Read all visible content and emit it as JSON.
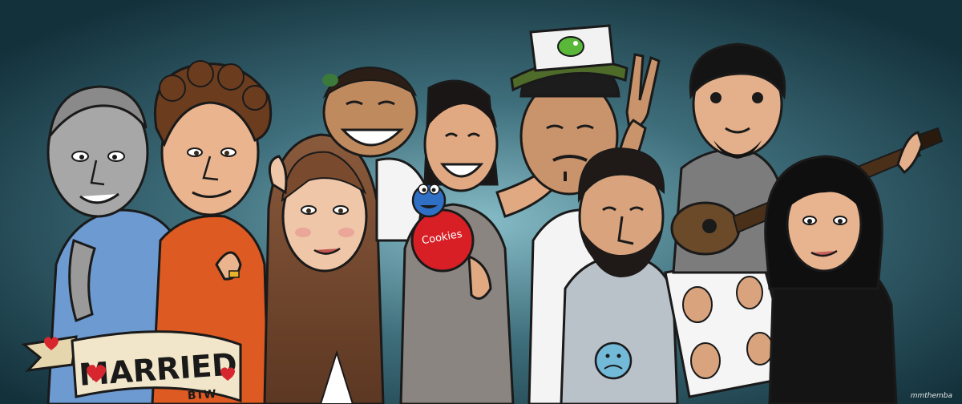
{
  "illustration": {
    "banner": {
      "main": "MARRIED",
      "sub": "BTW"
    },
    "jar_label": "Cookies",
    "signature": "mmthemba",
    "colors": {
      "background_center": "#7fb3bf",
      "background_edge": "#13313b",
      "banner_fill": "#f1e6c9",
      "heart_red": "#d8262f",
      "jar_red": "#d71f25",
      "cookie_monster_blue": "#2f6fc4",
      "cap_green": "#4f6b2a",
      "shirt_orange": "#dd5a22",
      "shirt_blue": "#6d9bd1"
    },
    "icons": [
      "heart-icon",
      "yoshi-emblem-icon",
      "sad-face-icon",
      "guitar-icon",
      "peace-sign-icon"
    ]
  }
}
